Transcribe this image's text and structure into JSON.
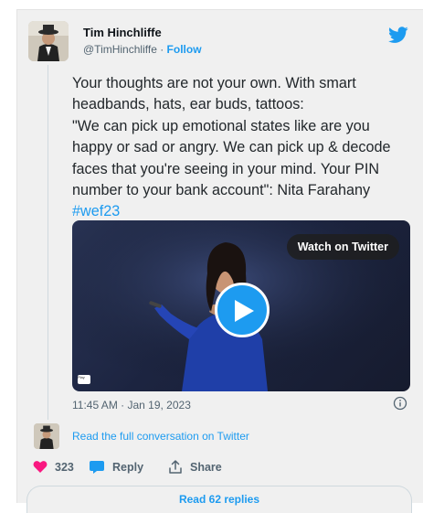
{
  "tweet": {
    "author_name": "Tim Hinchliffe",
    "author_handle": "@TimHinchliffe",
    "separator": " · ",
    "follow_label": "Follow",
    "text": "Your thoughts are not your own. With smart headbands, hats, ear buds, tattoos:\n\"We can pick up emotional states like are you happy or sad or angry. We can pick up & decode faces that you're seeing in your mind. Your PIN number to your bank account\": Nita Farahany ",
    "hashtag": "#wef23",
    "timestamp": "11:45 AM · Jan 19, 2023"
  },
  "video": {
    "watch_label": "Watch on Twitter",
    "badge": "Play"
  },
  "thread": {
    "read_conversation": "Read the full conversation on Twitter"
  },
  "actions": {
    "like_count": "323",
    "reply_label": "Reply",
    "share_label": "Share"
  },
  "footer": {
    "read_replies": "Read 62 replies"
  },
  "colors": {
    "accent": "#1d9bf0",
    "like": "#f91880",
    "card_bg": "#f0f0f0"
  },
  "icons": [
    "twitter-bird-icon",
    "play-icon",
    "info-icon",
    "heart-icon",
    "reply-bubble-icon",
    "share-icon"
  ]
}
